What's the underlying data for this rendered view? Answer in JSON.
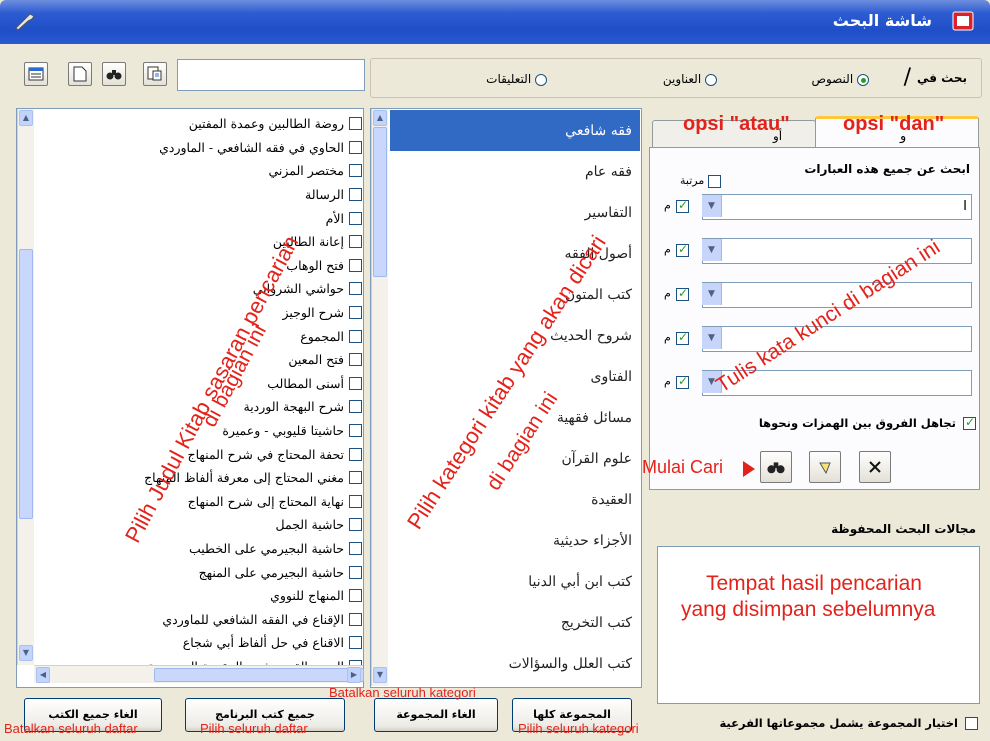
{
  "window": {
    "title": "شاشة البحث",
    "colors": {
      "titlebar": "#2c5bd2",
      "selection": "#316ac5",
      "annotation": "#e3231b"
    }
  },
  "search_scope": {
    "label": "بحث في",
    "separator": "/",
    "options": [
      {
        "label": "النصوص",
        "selected": true
      },
      {
        "label": "العناوين",
        "selected": false
      },
      {
        "label": "التعليقات",
        "selected": false
      }
    ]
  },
  "book_filter": {
    "value": "",
    "placeholder": ""
  },
  "books": [
    "روضة الطالبين وعمدة المفتين",
    "الحاوي في فقه الشافعي - الماوردي",
    "مختصر المزني",
    "الرسالة",
    "الأم",
    "إعانة الطالبين",
    "فتح الوهاب",
    "حواشي الشرواني",
    "شرح الوجيز",
    "المجموع",
    "فتح المعين",
    "أسنى المطالب",
    "شرح البهجة الوردية",
    "حاشيتا قليوبي - وعميرة",
    "تحفة المحتاج في شرح المنهاج",
    "مغني المحتاج إلى معرفة ألفاظ المنهاج",
    "نهاية المحتاج إلى شرح المنهاج",
    "حاشية الجمل",
    "حاشية البجيرمي على الخطيب",
    "حاشية البجيرمي على المنهج",
    "المنهاج للنووي",
    "الإقناع في الفقه الشافعي للماوردي",
    "الاقناع في حل ألفاظ أبي شجاع",
    "المنهج القويم شرح المقدمة الحضرمية"
  ],
  "categories": [
    "فقه شافعي",
    "فقه عام",
    "التفاسير",
    "أصول الفقه",
    "كتب المتون",
    "شروح الحديث",
    "الفتاوى",
    "مسائل فقهية",
    "علوم القرآن",
    "العقيدة",
    "الأجزاء حديثية",
    "كتب ابن أبي الدنيا",
    "كتب التخريج",
    "كتب العلل والسؤالات"
  ],
  "search_tabs": {
    "and_tab": "و",
    "or_tab": "أو"
  },
  "search_panel": {
    "all_phrases_label": "ابحث عن جميع هذه العبارات",
    "ordered_label": "مرتبة",
    "keyword_row_letter": "م",
    "first_input_value": "I",
    "ignore_hamza_label": "تجاهل الفروق بين الهمزات ونحوها"
  },
  "saved_searches": {
    "label": "مجالات البحث المحفوظة"
  },
  "include_subgroups_label": "اختيار المجموعة يشمل مجموعاتها الفرعية",
  "buttons": {
    "all_groups": "المجموعة كلها",
    "cancel_group": "الغاء المجموعة",
    "program_books": "جميع كتب البرنامج",
    "cancel_all_books": "الغاء جميع الكتب"
  },
  "annotations": {
    "opsi_dan": "opsi \"dan\"",
    "opsi_atau": "opsi \"atau\"",
    "tulis": "Tulis kata kunci di bagian ini",
    "mulai_cari": "Mulai Cari",
    "tempat_line1": "Tempat hasil pencarian",
    "tempat_line2": "yang disimpan sebelumnya",
    "pilih_kategori": "Pilih kategori  kitab yang akan dicari",
    "di_bagian_ini_cat": "di bagian ini",
    "pilih_judul": "Pilih Judul Kitab sasaran pencarian",
    "di_bagian_ini_books": "di bagian ini",
    "batalkan_kategori": "Batalkan seluruh kategori",
    "pilih_kategori_all": "Pilih seluruh kategori",
    "batalkan_daftar": "Batalkan seluruh daftar",
    "pilih_daftar": "Pilih seluruh daftar"
  }
}
